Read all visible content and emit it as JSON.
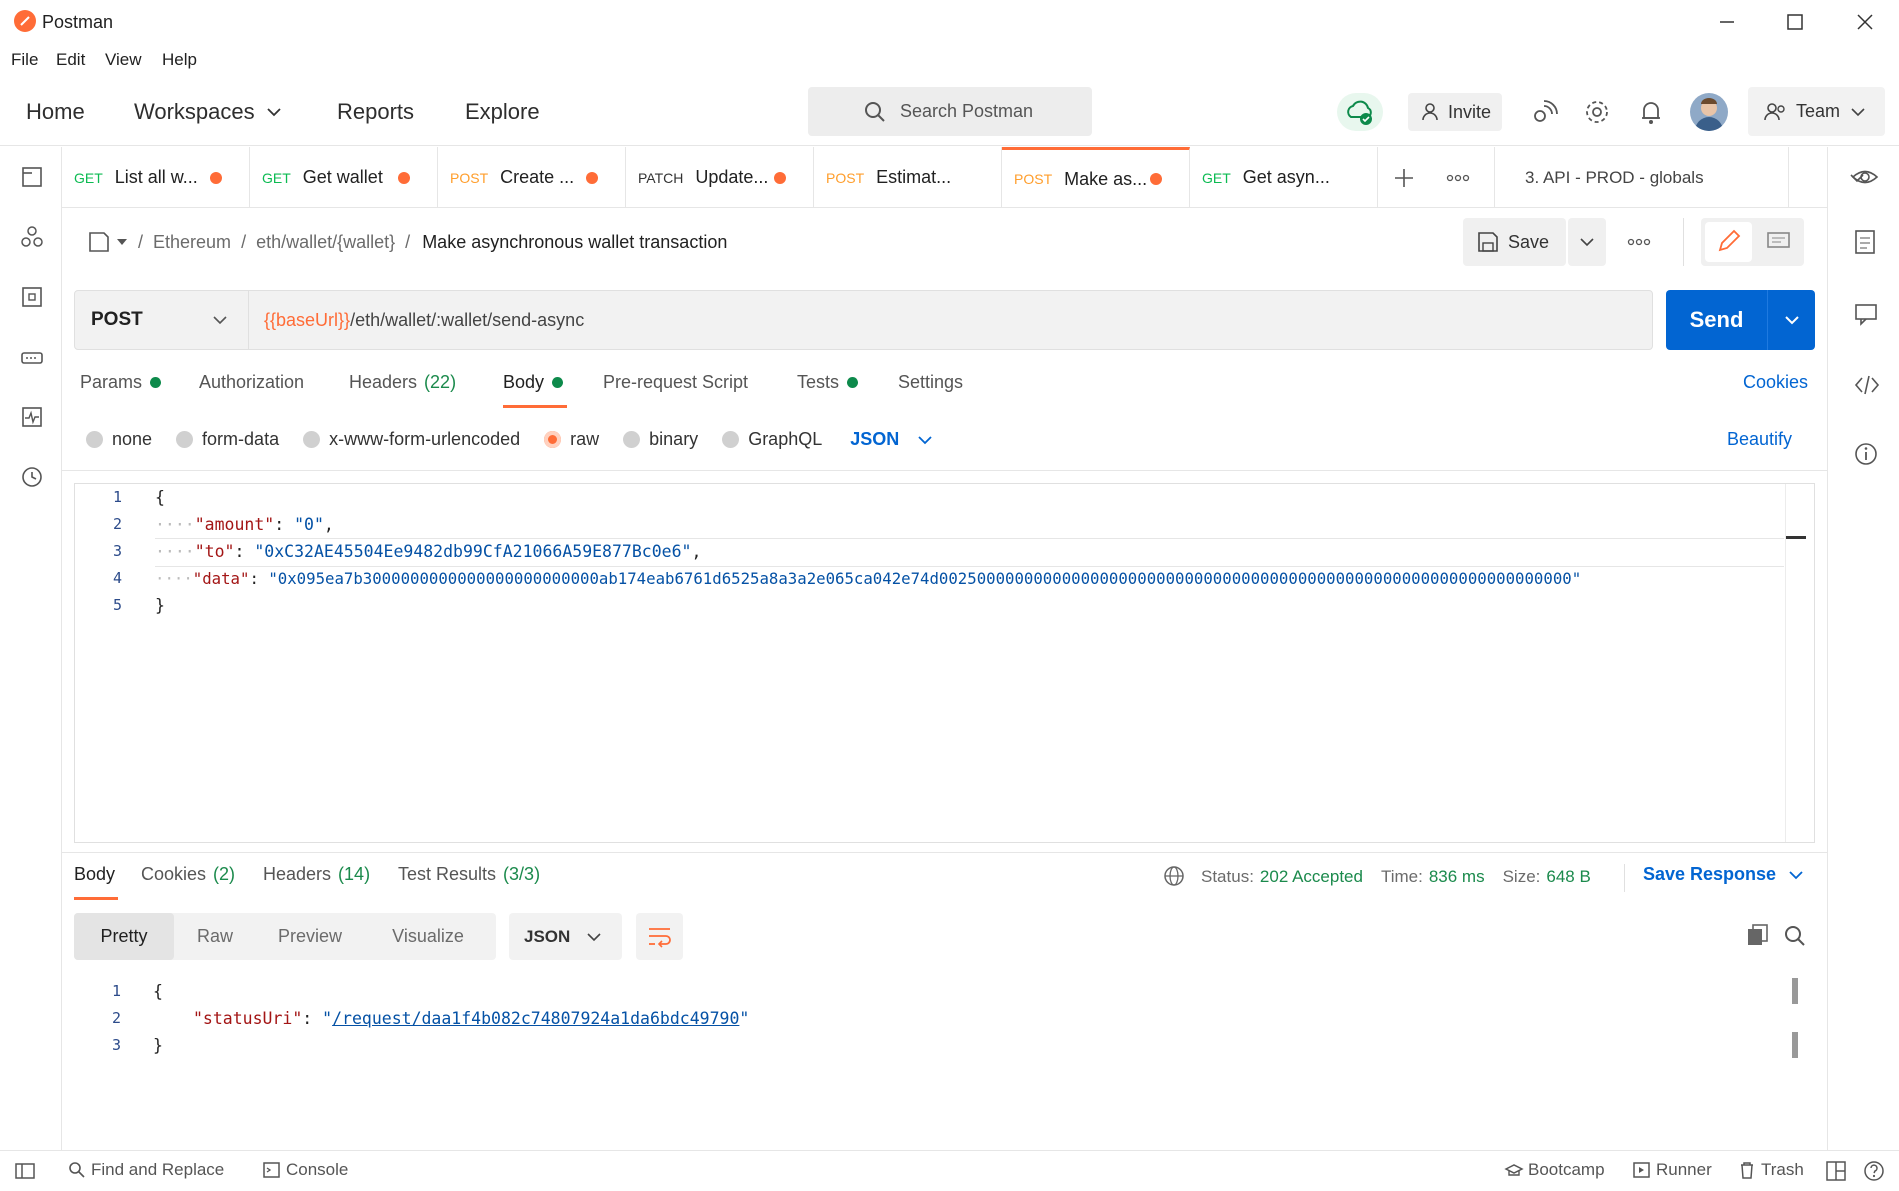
{
  "window": {
    "title": "Postman"
  },
  "menu": [
    "File",
    "Edit",
    "View",
    "Help"
  ],
  "header": {
    "nav": [
      "Home",
      "Workspaces",
      "Reports",
      "Explore"
    ],
    "search_placeholder": "Search Postman",
    "invite_label": "Invite",
    "team_label": "Team"
  },
  "tabs": [
    {
      "method": "GET",
      "label": "List all w...",
      "method_color": "#0cbb52"
    },
    {
      "method": "GET",
      "label": "Get wallet",
      "method_color": "#0cbb52"
    },
    {
      "method": "POST",
      "label": "Create ...",
      "method_color": "#ff9e2c"
    },
    {
      "method": "PATCH",
      "label": "Update...",
      "method_color": "#333333"
    },
    {
      "method": "POST",
      "label": "Estimat...",
      "method_color": "#ff9e2c"
    },
    {
      "method": "POST",
      "label": "Make as...",
      "method_color": "#ff9e2c"
    },
    {
      "method": "GET",
      "label": "Get asyn...",
      "method_color": "#0cbb52"
    }
  ],
  "environment": "3. API - PROD - globals",
  "breadcrumb": {
    "sep": "/",
    "collection": "Ethereum",
    "folder": "eth/wallet/{wallet}",
    "request": "Make asynchronous wallet transaction"
  },
  "save_label": "Save",
  "request": {
    "method": "POST",
    "url_var": "{{baseUrl}}",
    "url_rest": "/eth/wallet/:wallet/send-async",
    "send_label": "Send"
  },
  "request_tabs": {
    "params": "Params",
    "authorization": "Authorization",
    "headers": "Headers",
    "headers_count": "(22)",
    "body": "Body",
    "prerequest": "Pre-request Script",
    "tests": "Tests",
    "settings": "Settings",
    "cookies": "Cookies"
  },
  "body_types": {
    "none": "none",
    "formdata": "form-data",
    "urlencoded": "x-www-form-urlencoded",
    "raw": "raw",
    "binary": "binary",
    "graphql": "GraphQL",
    "format": "JSON",
    "beautify": "Beautify"
  },
  "request_body": {
    "line_numbers": [
      "1",
      "2",
      "3",
      "4",
      "5"
    ],
    "open": "{",
    "close": "}",
    "dots": "····",
    "amount_key": "\"amount\"",
    "amount_val": "\"0\"",
    "to_key": "\"to\"",
    "to_val": "\"0xC32AE45504Ee9482db99CfA21066A59E877Bc0e6\"",
    "data_key": "\"data\"",
    "data_val": "\"0x095ea7b3000000000000000000000000ab174eab6761d6525a8a3a2e065ca042e74d0025000000000000000000000000000000000000000000000000000000000000000\""
  },
  "response_tabs": {
    "body": "Body",
    "cookies": "Cookies",
    "cookies_count": "(2)",
    "headers": "Headers",
    "headers_count": "(14)",
    "tests": "Test Results",
    "tests_count": "(3/3)"
  },
  "response_meta": {
    "status_label": "Status:",
    "status_value": "202 Accepted",
    "time_label": "Time:",
    "time_value": "836 ms",
    "size_label": "Size:",
    "size_value": "648 B",
    "save_response": "Save Response"
  },
  "response_view": {
    "modes": [
      "Pretty",
      "Raw",
      "Preview",
      "Visualize"
    ],
    "format": "JSON"
  },
  "response_body": {
    "line_numbers": [
      "1",
      "2",
      "3"
    ],
    "open": "{",
    "close": "}",
    "key": "\"statusUri\"",
    "quote": "\"",
    "link": "/request/daa1f4b082c74807924a1da6bdc49790"
  },
  "footer": {
    "find_replace": "Find and Replace",
    "console": "Console",
    "bootcamp": "Bootcamp",
    "runner": "Runner",
    "trash": "Trash"
  }
}
